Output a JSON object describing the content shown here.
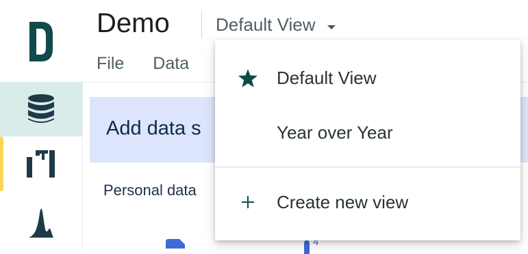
{
  "app": {
    "title": "Demo"
  },
  "view_selector": {
    "current": "Default View",
    "caret_icon": "caret-down-icon"
  },
  "menubar": {
    "items": [
      "File",
      "Data"
    ]
  },
  "rail": {
    "logo": "brand-d-logo",
    "items": [
      {
        "icon": "database-icon",
        "active": true
      },
      {
        "icon": "columns-icon",
        "active": false
      },
      {
        "icon": "distribution-chart-icon",
        "active": false
      }
    ],
    "indicator_color": "#fbd458"
  },
  "main": {
    "banner_title": "Add data s",
    "section_label": "Personal data",
    "badge_count": "4"
  },
  "dropdown": {
    "options": [
      {
        "label": "Default View",
        "icon": "star-icon",
        "selected": true
      },
      {
        "label": "Year over Year",
        "icon": "",
        "selected": false
      }
    ],
    "create_action": {
      "label": "Create new view",
      "icon": "plus-icon"
    }
  },
  "colors": {
    "brand": "#104a4a",
    "rail_active_bg": "#d9ece9",
    "banner_bg": "#dce5fb",
    "accent_blue": "#3d6bd6"
  }
}
